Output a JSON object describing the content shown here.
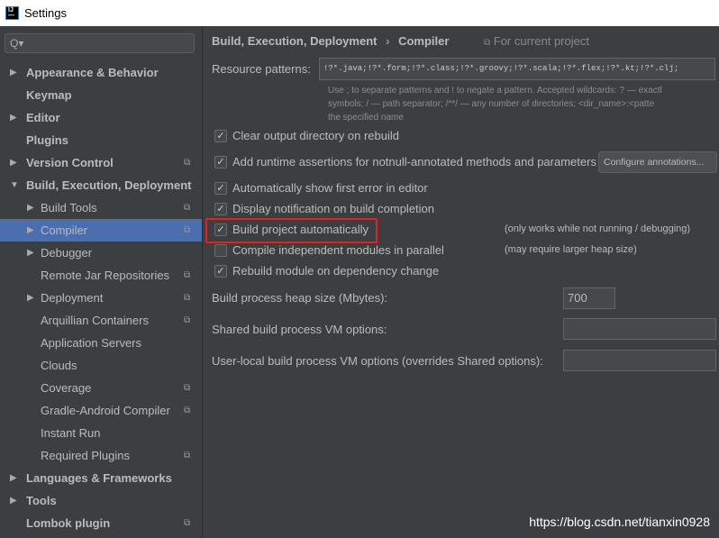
{
  "window": {
    "title": "Settings",
    "logo": "IJ"
  },
  "sidebar": {
    "search_placeholder": "Q▾",
    "items": [
      {
        "label": "Appearance & Behavior",
        "level": 0,
        "arrow": "right",
        "copy": false
      },
      {
        "label": "Keymap",
        "level": 0,
        "arrow": "",
        "copy": false
      },
      {
        "label": "Editor",
        "level": 0,
        "arrow": "right",
        "copy": false
      },
      {
        "label": "Plugins",
        "level": 0,
        "arrow": "",
        "copy": false
      },
      {
        "label": "Version Control",
        "level": 0,
        "arrow": "right",
        "copy": true
      },
      {
        "label": "Build, Execution, Deployment",
        "level": 0,
        "arrow": "down",
        "copy": false
      },
      {
        "label": "Build Tools",
        "level": 1,
        "arrow": "right",
        "copy": true
      },
      {
        "label": "Compiler",
        "level": 1,
        "arrow": "right",
        "copy": true,
        "selected": true
      },
      {
        "label": "Debugger",
        "level": 1,
        "arrow": "right",
        "copy": false
      },
      {
        "label": "Remote Jar Repositories",
        "level": 1,
        "arrow": "",
        "copy": true
      },
      {
        "label": "Deployment",
        "level": 1,
        "arrow": "right",
        "copy": true
      },
      {
        "label": "Arquillian Containers",
        "level": 1,
        "arrow": "",
        "copy": true
      },
      {
        "label": "Application Servers",
        "level": 1,
        "arrow": "",
        "copy": false
      },
      {
        "label": "Clouds",
        "level": 1,
        "arrow": "",
        "copy": false
      },
      {
        "label": "Coverage",
        "level": 1,
        "arrow": "",
        "copy": true
      },
      {
        "label": "Gradle-Android Compiler",
        "level": 1,
        "arrow": "",
        "copy": true
      },
      {
        "label": "Instant Run",
        "level": 1,
        "arrow": "",
        "copy": false
      },
      {
        "label": "Required Plugins",
        "level": 1,
        "arrow": "",
        "copy": true
      },
      {
        "label": "Languages & Frameworks",
        "level": 0,
        "arrow": "right",
        "copy": false
      },
      {
        "label": "Tools",
        "level": 0,
        "arrow": "right",
        "copy": false
      },
      {
        "label": "Lombok plugin",
        "level": 0,
        "arrow": "",
        "copy": true
      }
    ]
  },
  "header": {
    "crumb1": "Build, Execution, Deployment",
    "sep": "›",
    "crumb2": "Compiler",
    "scope": "For current project"
  },
  "resource": {
    "label": "Resource patterns:",
    "value": "!?*.java;!?*.form;!?*.class;!?*.groovy;!?*.scala;!?*.flex;!?*.kt;!?*.clj;",
    "hint1": "Use ; to separate patterns and ! to negate a pattern. Accepted wildcards: ? — exactl",
    "hint2": "symbols; / — path separator; /**/ — any number of directories; <dir_name>:<patte",
    "hint3": "the specified name"
  },
  "options": [
    {
      "label": "Clear output directory on rebuild",
      "checked": true
    },
    {
      "label": "Add runtime assertions for notnull-annotated methods and parameters",
      "checked": true
    },
    {
      "label": "Automatically show first error in editor",
      "checked": true
    },
    {
      "label": "Display notification on build completion",
      "checked": true
    },
    {
      "label": "Build project automatically",
      "checked": true,
      "note": "(only works while not running / debugging)"
    },
    {
      "label": "Compile independent modules in parallel",
      "checked": false,
      "note": "(may require larger heap size)"
    },
    {
      "label": "Rebuild module on dependency change",
      "checked": true
    }
  ],
  "configure_button": "Configure annotations...",
  "heap": {
    "label": "Build process heap size (Mbytes):",
    "value": "700"
  },
  "shared_vm": {
    "label": "Shared build process VM options:",
    "value": ""
  },
  "user_vm": {
    "label": "User-local build process VM options (overrides Shared options):",
    "value": ""
  },
  "watermark": "https://blog.csdn.net/tianxin0928",
  "colors": {
    "selection": "#4b6eaf",
    "highlight_box": "#e8201c",
    "background": "#3c3f41"
  }
}
